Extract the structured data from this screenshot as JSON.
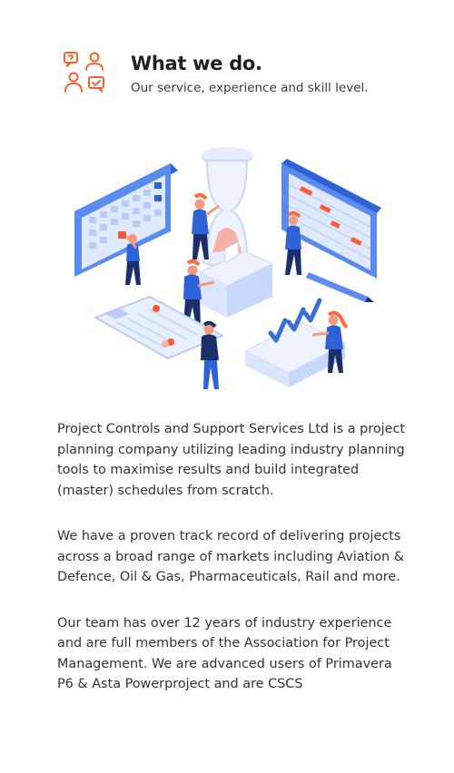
{
  "header": {
    "icon": "team-support-icon",
    "title": "What we do.",
    "subtitle": "Our service, experience and skill level."
  },
  "illustration": {
    "name": "project-planning-illustration",
    "accent": "#ff6b3d",
    "primary": "#3a6fd9"
  },
  "content": {
    "paragraphs": [
      "Project Controls and Support Services Ltd is a project planning company utilizing leading industry planning tools to maximise results and build integrated (master) schedules from scratch.",
      "We have a proven track record of delivering projects across a broad range of markets including Aviation & Defence, Oil & Gas, Pharmaceuticals, Rail and more.",
      "Our team has over 12 years of industry experience and are full members of the Association for Project Management. We are advanced users of Primavera P6 & Asta Powerproject and are CSCS"
    ]
  }
}
